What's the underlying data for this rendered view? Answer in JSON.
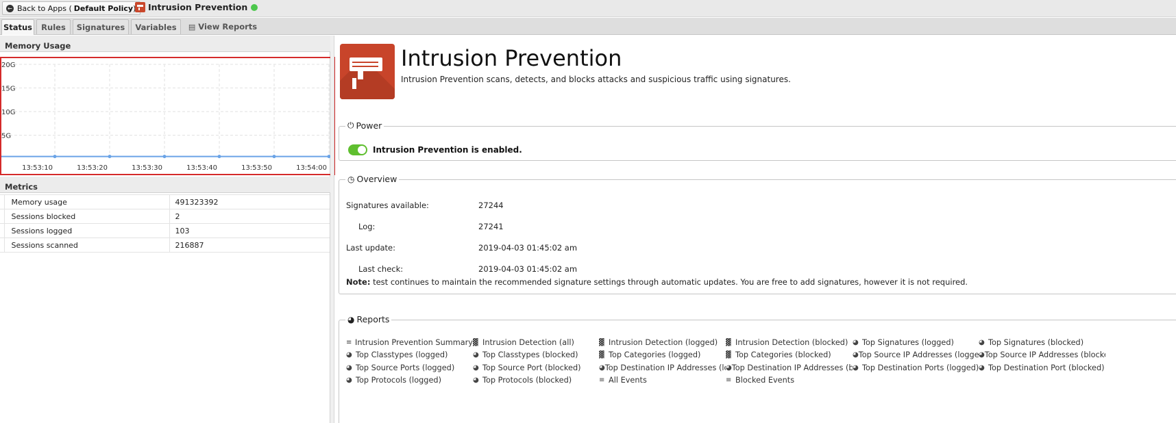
{
  "topbar": {
    "back_label": "Back to Apps (",
    "back_policy": "Default Policy",
    "back_close": ")",
    "app_title": "Intrusion Prevention",
    "status": "running",
    "status_color": "#4cc74c"
  },
  "tabs": [
    {
      "label": "Status",
      "active": true
    },
    {
      "label": "Rules"
    },
    {
      "label": "Signatures"
    },
    {
      "label": "Variables"
    },
    {
      "label": "View Reports"
    }
  ],
  "memory_panel": {
    "header": "Memory Usage"
  },
  "chart_data": {
    "type": "line",
    "title": "",
    "xlabel": "",
    "ylabel": "",
    "y_ticks": [
      "20G",
      "15G",
      "10G",
      "5G"
    ],
    "x_ticks": [
      "13:53:10",
      "13:53:20",
      "13:53:30",
      "13:53:40",
      "13:53:50",
      "13:54:00"
    ],
    "ylim": [
      0,
      20
    ],
    "grid": true,
    "series": [
      {
        "x": [
          "13:53:00",
          "13:53:10",
          "13:53:20",
          "13:53:30",
          "13:53:40",
          "13:53:50",
          "13:54:00"
        ],
        "values": [
          0.49,
          0.49,
          0.49,
          0.49,
          0.49,
          0.49,
          0.49
        ]
      }
    ],
    "color": "#6aa3e6"
  },
  "metrics_panel": {
    "header": "Metrics",
    "rows": [
      {
        "name": "Memory usage",
        "value": "491323392"
      },
      {
        "name": "Sessions blocked",
        "value": "2"
      },
      {
        "name": "Sessions logged",
        "value": "103"
      },
      {
        "name": "Sessions scanned",
        "value": "216887"
      }
    ]
  },
  "app": {
    "title": "Intrusion Prevention",
    "description": "Intrusion Prevention scans, detects, and blocks attacks and suspicious traffic using signatures.",
    "icon_color": "#c8442a"
  },
  "power": {
    "legend": "Power",
    "enabled": true,
    "text": "Intrusion Prevention is enabled."
  },
  "overview": {
    "legend": "Overview",
    "rows": [
      {
        "label": "Signatures available:",
        "value": "27244"
      },
      {
        "label": "Log:",
        "value": "27241"
      },
      {
        "label": "Last update:",
        "value": "2019-04-03 01:45:02 am"
      },
      {
        "label": "Last check:",
        "value": "2019-04-03 01:45:02 am"
      }
    ],
    "note_label": "Note:",
    "note_text": " test continues to maintain the recommended signature settings through automatic updates. You are free to add signatures, however it is not required."
  },
  "reports": {
    "legend": "Reports",
    "links": [
      {
        "label": "Intrusion Prevention Summary",
        "icon": "list-icon"
      },
      {
        "label": "Intrusion Detection (all)",
        "icon": "bar-chart-icon"
      },
      {
        "label": "Intrusion Detection (logged)",
        "icon": "bar-chart-icon"
      },
      {
        "label": "Intrusion Detection (blocked)",
        "icon": "bar-chart-icon"
      },
      {
        "label": "Top Signatures (logged)",
        "icon": "pie-chart-icon"
      },
      {
        "label": "Top Signatures (blocked)",
        "icon": "pie-chart-icon"
      },
      {
        "label": "Top Classtypes (logged)",
        "icon": "pie-chart-icon"
      },
      {
        "label": "Top Classtypes (blocked)",
        "icon": "pie-chart-icon"
      },
      {
        "label": "Top Categories (logged)",
        "icon": "bar-chart-icon"
      },
      {
        "label": "Top Categories (blocked)",
        "icon": "bar-chart-icon"
      },
      {
        "label": "Top Source IP Addresses (logged)",
        "icon": "pie-chart-icon"
      },
      {
        "label": "Top Source IP Addresses (blocke...",
        "icon": "pie-chart-icon"
      },
      {
        "label": "Top Source Ports (logged)",
        "icon": "pie-chart-icon"
      },
      {
        "label": "Top Source Port (blocked)",
        "icon": "pie-chart-icon"
      },
      {
        "label": "Top Destination IP Addresses (lo...",
        "icon": "pie-chart-icon"
      },
      {
        "label": "Top Destination IP Addresses (bl...",
        "icon": "pie-chart-icon"
      },
      {
        "label": "Top Destination Ports (logged)",
        "icon": "pie-chart-icon"
      },
      {
        "label": "Top Destination Port (blocked)",
        "icon": "pie-chart-icon"
      },
      {
        "label": "Top Protocols (logged)",
        "icon": "pie-chart-icon"
      },
      {
        "label": "Top Protocols (blocked)",
        "icon": "pie-chart-icon"
      },
      {
        "label": "All Events",
        "icon": "list-icon"
      },
      {
        "label": "Blocked Events",
        "icon": "list-icon"
      }
    ]
  }
}
